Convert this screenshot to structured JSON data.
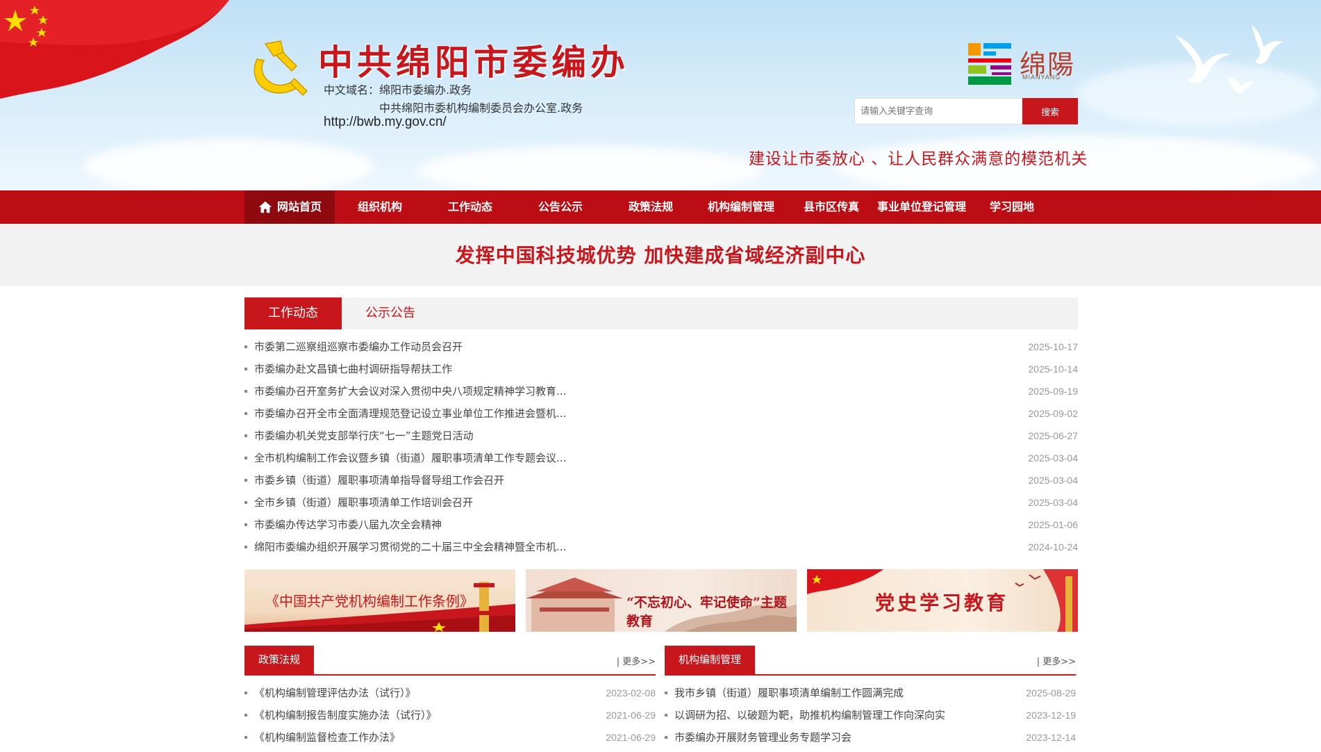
{
  "header": {
    "site_title": "中共绵阳市委编办",
    "domain_label_1": "中文域名：绵阳市委编办.政务",
    "domain_label_2": "中共绵阳市委机构编制委员会办公室.政务",
    "url": "http://bwb.my.gov.cn/",
    "city_logo_text": "绵陽",
    "city_logo_sub": "MIANYANG",
    "search_placeholder": "请输入关键字查询",
    "search_button": "搜索",
    "slogan": "建设让市委放心 、让人民群众满意的模范机关"
  },
  "nav": [
    {
      "label": "网站首页",
      "active": true
    },
    {
      "label": "组织机构",
      "active": false
    },
    {
      "label": "工作动态",
      "active": false
    },
    {
      "label": "公告公示",
      "active": false
    },
    {
      "label": "政策法规",
      "active": false
    },
    {
      "label": "机构编制管理",
      "active": false
    },
    {
      "label": "县市区传真",
      "active": false
    },
    {
      "label": "事业单位登记管理",
      "active": false
    },
    {
      "label": "学习园地",
      "active": false
    }
  ],
  "banner": "发挥中国科技城优势 加快建成省域经济副中心",
  "tabs": [
    "工作动态",
    "公示公告"
  ],
  "news": [
    {
      "title": "市委第二巡察组巡察市委编办工作动员会召开",
      "date": "2025-10-17"
    },
    {
      "title": "市委编办赴文昌镇七曲村调研指导帮扶工作",
      "date": "2025-10-14"
    },
    {
      "title": "市委编办召开室务扩大会议对深入贯彻中央八项规定精神学习教育...",
      "date": "2025-09-19"
    },
    {
      "title": "市委编办召开全市全面清理规范登记设立事业单位工作推进会暨机...",
      "date": "2025-09-02"
    },
    {
      "title": "市委编办机关党支部举行庆“七一”主题党日活动",
      "date": "2025-06-27"
    },
    {
      "title": "全市机构编制工作会议暨乡镇（街道）履职事项清单工作专题会议...",
      "date": "2025-03-04"
    },
    {
      "title": "市委乡镇（街道）履职事项清单指导督导组工作会召开",
      "date": "2025-03-04"
    },
    {
      "title": "全市乡镇（街道）履职事项清单工作培训会召开",
      "date": "2025-03-04"
    },
    {
      "title": "市委编办传达学习市委八届九次全会精神",
      "date": "2025-01-06"
    },
    {
      "title": "绵阳市委编办组织开展学习贯彻党的二十届三中全会精神暨全市机...",
      "date": "2024-10-24"
    }
  ],
  "promos": [
    "《中国共产党机构编制工作条例》",
    "“不忘初心、牢记使命”主题教育",
    "党史学习教育"
  ],
  "policy": {
    "title": "政策法规",
    "more": "| 更多>>",
    "items": [
      {
        "title": "《机构编制管理评估办法（试行）》",
        "date": "2023-02-08"
      },
      {
        "title": "《机构编制报告制度实施办法（试行）》",
        "date": "2021-06-29"
      },
      {
        "title": "《机构编制监督检查工作办法》",
        "date": "2021-06-29"
      }
    ]
  },
  "org": {
    "title": "机构编制管理",
    "more": "| 更多>>",
    "items": [
      {
        "title": "我市乡镇（街道）履职事项清单编制工作圆满完成",
        "date": "2025-08-29"
      },
      {
        "title": "以调研为招、以破题为靶，助推机构编制管理工作向深向实",
        "date": "2023-12-19"
      },
      {
        "title": "市委编办开展财务管理业务专题学习会",
        "date": "2023-12-14"
      }
    ]
  },
  "colors": {
    "primary_red": "#c8161d",
    "nav_red": "#bd0d14",
    "nav_active": "#8e0a0f"
  }
}
